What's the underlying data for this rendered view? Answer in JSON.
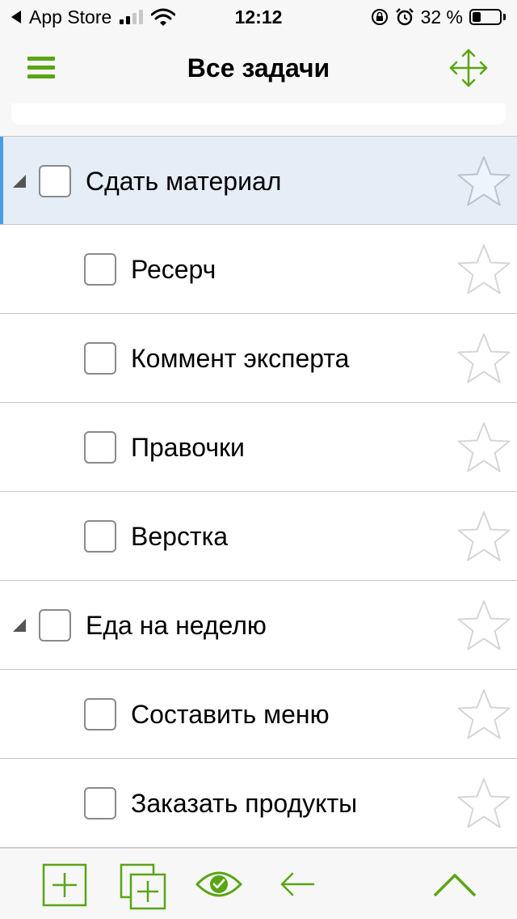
{
  "status_bar": {
    "back_app": "App Store",
    "time": "12:12",
    "battery_text": "32 %",
    "battery_level": 0.32
  },
  "header": {
    "title": "Все задачи",
    "accent_color": "#5aa514"
  },
  "tasks": [
    {
      "label": "Сдать материал",
      "level": 0,
      "expandable": true,
      "selected": true,
      "checked": false,
      "starred": false
    },
    {
      "label": "Ресерч",
      "level": 1,
      "expandable": false,
      "selected": false,
      "checked": false,
      "starred": false
    },
    {
      "label": "Коммент эксперта",
      "level": 1,
      "expandable": false,
      "selected": false,
      "checked": false,
      "starred": false
    },
    {
      "label": "Правочки",
      "level": 1,
      "expandable": false,
      "selected": false,
      "checked": false,
      "starred": false
    },
    {
      "label": "Верстка",
      "level": 1,
      "expandable": false,
      "selected": false,
      "checked": false,
      "starred": false
    },
    {
      "label": "Еда на неделю",
      "level": 0,
      "expandable": true,
      "selected": false,
      "checked": false,
      "starred": false
    },
    {
      "label": "Составить меню",
      "level": 1,
      "expandable": false,
      "selected": false,
      "checked": false,
      "starred": false
    },
    {
      "label": "Заказать продукты",
      "level": 1,
      "expandable": false,
      "selected": false,
      "checked": false,
      "starred": false
    }
  ],
  "toolbar": {
    "buttons": [
      "add-task-icon",
      "add-subtask-icon",
      "view-options-icon",
      "back-arrow-icon",
      "collapse-up-icon"
    ]
  }
}
